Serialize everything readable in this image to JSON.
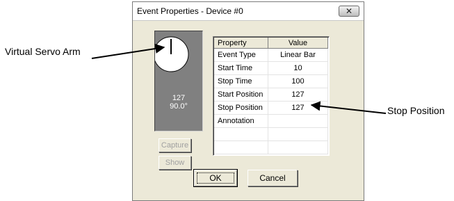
{
  "callouts": {
    "left_label": "Virtual Servo Arm",
    "right_label": "Stop Position"
  },
  "dialog": {
    "title": "Event Properties - Device #0",
    "close_label": "✕"
  },
  "servo": {
    "value": "127",
    "angle": "90.0°"
  },
  "buttons": {
    "capture": "Capture",
    "show": "Show",
    "ok": "OK",
    "cancel": "Cancel"
  },
  "table": {
    "headers": [
      "Property",
      "Value"
    ],
    "rows": [
      [
        "Event Type",
        "Linear Bar"
      ],
      [
        "Start Time",
        "10"
      ],
      [
        "Stop Time",
        "100"
      ],
      [
        "Start Position",
        "127"
      ],
      [
        "Stop Position",
        "127"
      ],
      [
        "Annotation",
        ""
      ],
      [
        "",
        ""
      ],
      [
        "",
        ""
      ]
    ]
  },
  "colors": {
    "dialog_bg": "#ece9d8",
    "servo_panel": "#808080",
    "servo_text": "#ffffff",
    "disabled_text": "#a0a0a0"
  },
  "icons": {
    "close": "close-icon",
    "servo_dial": "servo-dial-icon"
  }
}
